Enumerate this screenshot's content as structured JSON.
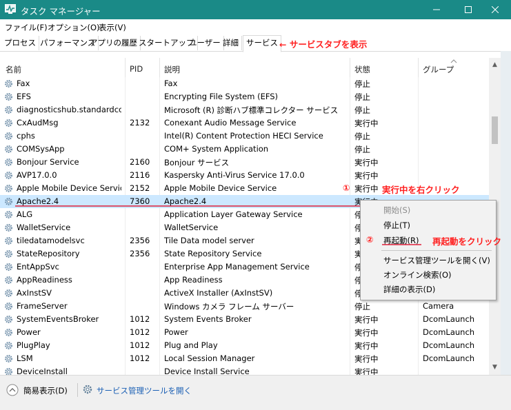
{
  "window": {
    "title": "タスク マネージャー"
  },
  "menu": [
    "ファイル(F)",
    "オプション(O)",
    "表示(V)"
  ],
  "tabs": [
    "プロセス",
    "パフォーマンス",
    "アプリの履歴",
    "スタートアップ",
    "ユーザー",
    "詳細",
    "サービス"
  ],
  "annotations": {
    "tab_note": "← サービスタブを表示",
    "step1_num": "①",
    "step1": "実行中を右クリック",
    "step2_num": "②",
    "step2": "再起動をクリック"
  },
  "columns": [
    "名前",
    "PID",
    "説明",
    "状態",
    "グループ"
  ],
  "rows": [
    {
      "name": "Fax",
      "pid": "",
      "desc": "Fax",
      "status": "停止",
      "group": ""
    },
    {
      "name": "EFS",
      "pid": "",
      "desc": "Encrypting File System (EFS)",
      "status": "停止",
      "group": ""
    },
    {
      "name": "diagnosticshub.standardco...",
      "pid": "",
      "desc": "Microsoft (R) 診断ハブ標準コレクター サービス",
      "status": "停止",
      "group": ""
    },
    {
      "name": "CxAudMsg",
      "pid": "2132",
      "desc": "Conexant Audio Message Service",
      "status": "実行中",
      "group": ""
    },
    {
      "name": "cphs",
      "pid": "",
      "desc": "Intel(R) Content Protection HECI Service",
      "status": "停止",
      "group": ""
    },
    {
      "name": "COMSysApp",
      "pid": "",
      "desc": "COM+ System Application",
      "status": "停止",
      "group": ""
    },
    {
      "name": "Bonjour Service",
      "pid": "2160",
      "desc": "Bonjour サービス",
      "status": "実行中",
      "group": ""
    },
    {
      "name": "AVP17.0.0",
      "pid": "2116",
      "desc": "Kaspersky Anti-Virus Service 17.0.0",
      "status": "実行中",
      "group": ""
    },
    {
      "name": "Apple Mobile Device Service",
      "pid": "2152",
      "desc": "Apple Mobile Device Service",
      "status": "実行中",
      "group": ""
    },
    {
      "name": "Apache2.4",
      "pid": "7360",
      "desc": "Apache2.4",
      "status": "実行中",
      "group": ""
    },
    {
      "name": "ALG",
      "pid": "",
      "desc": "Application Layer Gateway Service",
      "status": "停止",
      "group": ""
    },
    {
      "name": "WalletService",
      "pid": "",
      "desc": "WalletService",
      "status": "停止",
      "group": ""
    },
    {
      "name": "tiledatamodelsvc",
      "pid": "2356",
      "desc": "Tile Data model server",
      "status": "実行中",
      "group": ""
    },
    {
      "name": "StateRepository",
      "pid": "2356",
      "desc": "State Repository Service",
      "status": "実行中",
      "group": ""
    },
    {
      "name": "EntAppSvc",
      "pid": "",
      "desc": "Enterprise App Management Service",
      "status": "停止",
      "group": ""
    },
    {
      "name": "AppReadiness",
      "pid": "",
      "desc": "App Readiness",
      "status": "停止",
      "group": ""
    },
    {
      "name": "AxInstSV",
      "pid": "",
      "desc": "ActiveX Installer (AxInstSV)",
      "status": "停止",
      "group": ""
    },
    {
      "name": "FrameServer",
      "pid": "",
      "desc": "Windows カメラ フレーム サーバー",
      "status": "停止",
      "group": "Camera"
    },
    {
      "name": "SystemEventsBroker",
      "pid": "1012",
      "desc": "System Events Broker",
      "status": "実行中",
      "group": "DcomLaunch"
    },
    {
      "name": "Power",
      "pid": "1012",
      "desc": "Power",
      "status": "実行中",
      "group": "DcomLaunch"
    },
    {
      "name": "PlugPlay",
      "pid": "1012",
      "desc": "Plug and Play",
      "status": "実行中",
      "group": "DcomLaunch"
    },
    {
      "name": "LSM",
      "pid": "1012",
      "desc": "Local Session Manager",
      "status": "実行中",
      "group": "DcomLaunch"
    },
    {
      "name": "DeviceInstall",
      "pid": "",
      "desc": "Device Install Service",
      "status": "実行中",
      "group": ""
    }
  ],
  "context_menu": {
    "start": "開始(S)",
    "stop": "停止(T)",
    "restart": "再起動(R)",
    "open_services": "サービス管理ツールを開く(V)",
    "search_online": "オンライン検索(O)",
    "details": "詳細の表示(D)"
  },
  "bottom": {
    "fewer_details": "簡易表示(D)",
    "open_services": "サービス管理ツールを開く"
  },
  "colors": {
    "titlebar": "#1a8a87",
    "selection": "#cce8ff",
    "annotation": "#ff1f1f",
    "link": "#1a5fb4"
  }
}
